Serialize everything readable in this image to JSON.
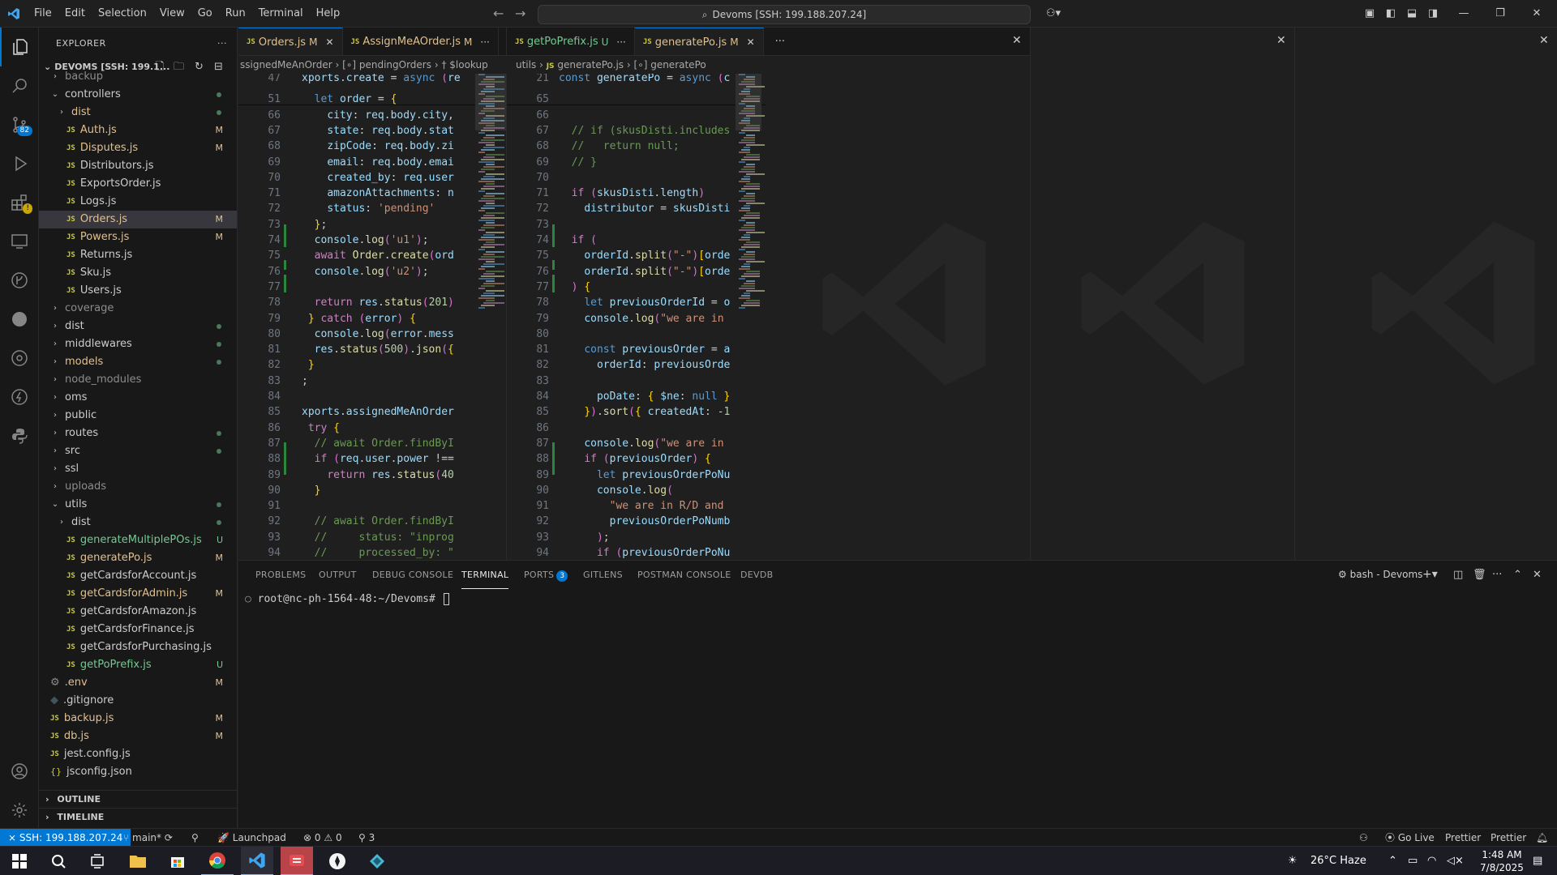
{
  "titlebar": {
    "menu": [
      "File",
      "Edit",
      "Selection",
      "View",
      "Go",
      "Run",
      "Terminal",
      "Help"
    ],
    "command_center": "Devoms [SSH: 199.188.207.24]"
  },
  "sidebar": {
    "title": "EXPLORER",
    "workspace": "DEVOMS [SSH: 199.1...",
    "items": [
      {
        "label": "backup",
        "indent": 1,
        "type": "folder",
        "open": false,
        "color": "ign",
        "status": "",
        "dot": false
      },
      {
        "label": "controllers",
        "indent": 1,
        "type": "folder",
        "open": true,
        "color": "norm",
        "status": "",
        "dot": true
      },
      {
        "label": "dist",
        "indent": 2,
        "type": "folder",
        "open": false,
        "color": "mod",
        "status": "",
        "dot": true
      },
      {
        "label": "Auth.js",
        "indent": 2,
        "type": "js",
        "color": "mod",
        "status": "M"
      },
      {
        "label": "Disputes.js",
        "indent": 2,
        "type": "js",
        "color": "mod",
        "status": "M"
      },
      {
        "label": "Distributors.js",
        "indent": 2,
        "type": "js",
        "color": "norm",
        "status": ""
      },
      {
        "label": "ExportsOrder.js",
        "indent": 2,
        "type": "js",
        "color": "norm",
        "status": ""
      },
      {
        "label": "Logs.js",
        "indent": 2,
        "type": "js",
        "color": "norm",
        "status": ""
      },
      {
        "label": "Orders.js",
        "indent": 2,
        "type": "js",
        "color": "mod",
        "status": "M",
        "selected": true
      },
      {
        "label": "Powers.js",
        "indent": 2,
        "type": "js",
        "color": "mod",
        "status": "M"
      },
      {
        "label": "Returns.js",
        "indent": 2,
        "type": "js",
        "color": "norm",
        "status": ""
      },
      {
        "label": "Sku.js",
        "indent": 2,
        "type": "js",
        "color": "norm",
        "status": ""
      },
      {
        "label": "Users.js",
        "indent": 2,
        "type": "js",
        "color": "norm",
        "status": ""
      },
      {
        "label": "coverage",
        "indent": 1,
        "type": "folder",
        "open": false,
        "color": "ign",
        "status": "",
        "dot": false
      },
      {
        "label": "dist",
        "indent": 1,
        "type": "folder",
        "open": false,
        "color": "norm",
        "status": "",
        "dot": true
      },
      {
        "label": "middlewares",
        "indent": 1,
        "type": "folder",
        "open": false,
        "color": "norm",
        "status": "",
        "dot": true
      },
      {
        "label": "models",
        "indent": 1,
        "type": "folder",
        "open": false,
        "color": "mod",
        "status": "",
        "dot": true
      },
      {
        "label": "node_modules",
        "indent": 1,
        "type": "folder",
        "open": false,
        "color": "ign",
        "status": "",
        "dot": false
      },
      {
        "label": "oms",
        "indent": 1,
        "type": "folder",
        "open": false,
        "color": "norm",
        "status": "",
        "dot": false
      },
      {
        "label": "public",
        "indent": 1,
        "type": "folder",
        "open": false,
        "color": "norm",
        "status": "",
        "dot": false
      },
      {
        "label": "routes",
        "indent": 1,
        "type": "folder",
        "open": false,
        "color": "norm",
        "status": "",
        "dot": true
      },
      {
        "label": "src",
        "indent": 1,
        "type": "folder",
        "open": false,
        "color": "norm",
        "status": "",
        "dot": true
      },
      {
        "label": "ssl",
        "indent": 1,
        "type": "folder",
        "open": false,
        "color": "norm",
        "status": "",
        "dot": false
      },
      {
        "label": "uploads",
        "indent": 1,
        "type": "folder",
        "open": false,
        "color": "ign",
        "status": "",
        "dot": false
      },
      {
        "label": "utils",
        "indent": 1,
        "type": "folder",
        "open": true,
        "color": "norm",
        "status": "",
        "dot": true
      },
      {
        "label": "dist",
        "indent": 2,
        "type": "folder",
        "open": false,
        "color": "norm",
        "status": "",
        "dot": true
      },
      {
        "label": "generateMultiplePOs.js",
        "indent": 2,
        "type": "js",
        "color": "new",
        "status": "U"
      },
      {
        "label": "generatePo.js",
        "indent": 2,
        "type": "js",
        "color": "mod",
        "status": "M"
      },
      {
        "label": "getCardsforAccount.js",
        "indent": 2,
        "type": "js",
        "color": "norm",
        "status": ""
      },
      {
        "label": "getCardsforAdmin.js",
        "indent": 2,
        "type": "js",
        "color": "mod",
        "status": "M"
      },
      {
        "label": "getCardsforAmazon.js",
        "indent": 2,
        "type": "js",
        "color": "norm",
        "status": ""
      },
      {
        "label": "getCardsforFinance.js",
        "indent": 2,
        "type": "js",
        "color": "norm",
        "status": ""
      },
      {
        "label": "getCardsforPurchasing.js",
        "indent": 2,
        "type": "js",
        "color": "norm",
        "status": ""
      },
      {
        "label": "getPoPrefix.js",
        "indent": 2,
        "type": "js",
        "color": "new",
        "status": "U"
      },
      {
        "label": ".env",
        "indent": 1,
        "type": "gear",
        "color": "mod",
        "status": "M"
      },
      {
        "label": ".gitignore",
        "indent": 1,
        "type": "git",
        "color": "norm",
        "status": ""
      },
      {
        "label": "backup.js",
        "indent": 1,
        "type": "js",
        "color": "mod",
        "status": "M"
      },
      {
        "label": "db.js",
        "indent": 1,
        "type": "js",
        "color": "mod",
        "status": "M"
      },
      {
        "label": "jest.config.js",
        "indent": 1,
        "type": "js",
        "color": "norm",
        "status": ""
      },
      {
        "label": "jsconfig.json",
        "indent": 1,
        "type": "json",
        "color": "norm",
        "status": ""
      }
    ],
    "outline": "OUTLINE",
    "timeline": "TIMELINE"
  },
  "editor1": {
    "tabs": [
      {
        "name": "Orders.js",
        "status": "M",
        "active": true
      },
      {
        "name": "AssignMeAOrder.js",
        "status": "M",
        "active": false
      }
    ],
    "breadcrumbs": [
      "ssignedMeAnOrder",
      "[∘] pendingOrders",
      "† $lookup"
    ],
    "lines": [
      {
        "n": "47",
        "c": "xports.create = async (re"
      },
      {
        "n": "51",
        "c": "  let order = {"
      },
      {
        "n": "66",
        "c": "    city: req.body.city,"
      },
      {
        "n": "67",
        "c": "    state: req.body.stat"
      },
      {
        "n": "68",
        "c": "    zipCode: req.body.zi"
      },
      {
        "n": "69",
        "c": "    email: req.body.emai"
      },
      {
        "n": "70",
        "c": "    created_by: req.user"
      },
      {
        "n": "71",
        "c": "    amazonAttachments: n"
      },
      {
        "n": "72",
        "c": "    status: 'pending'"
      },
      {
        "n": "73",
        "c": "  };"
      },
      {
        "n": "74",
        "c": "  console.log('u1');"
      },
      {
        "n": "75",
        "c": "  await Order.create(ord"
      },
      {
        "n": "76",
        "c": "  console.log('u2');"
      },
      {
        "n": "77",
        "c": ""
      },
      {
        "n": "78",
        "c": "  return res.status(201)"
      },
      {
        "n": "79",
        "c": " } catch (error) {"
      },
      {
        "n": "80",
        "c": "  console.log(error.mess"
      },
      {
        "n": "81",
        "c": "  res.status(500).json({"
      },
      {
        "n": "82",
        "c": " }"
      },
      {
        "n": "83",
        "c": ";"
      },
      {
        "n": "84",
        "c": ""
      },
      {
        "n": "85",
        "c": "xports.assignedMeAnOrder"
      },
      {
        "n": "86",
        "c": " try {"
      },
      {
        "n": "87",
        "c": "  // await Order.findByI"
      },
      {
        "n": "88",
        "c": "  if (req.user.power !=="
      },
      {
        "n": "89",
        "c": "    return res.status(40"
      },
      {
        "n": "90",
        "c": "  }"
      },
      {
        "n": "91",
        "c": ""
      },
      {
        "n": "92",
        "c": "  // await Order.findByI"
      },
      {
        "n": "93",
        "c": "  //     status: \"inprog"
      },
      {
        "n": "94",
        "c": "  //     processed_by: \""
      }
    ]
  },
  "editor2": {
    "tabs": [
      {
        "name": "getPoPrefix.js",
        "status": "U",
        "active": false
      },
      {
        "name": "generatePo.js",
        "status": "M",
        "active": true
      }
    ],
    "breadcrumbs": [
      "utils",
      "generatePo.js",
      "[∘] generatePo"
    ],
    "lines": [
      {
        "n": "21",
        "c": "const generatePo = async (c"
      },
      {
        "n": "65",
        "c": ""
      },
      {
        "n": "66",
        "c": ""
      },
      {
        "n": "67",
        "c": "  // if (skusDisti.includes"
      },
      {
        "n": "68",
        "c": "  //   return null;"
      },
      {
        "n": "69",
        "c": "  // }"
      },
      {
        "n": "70",
        "c": ""
      },
      {
        "n": "71",
        "c": "  if (skusDisti.length)"
      },
      {
        "n": "72",
        "c": "    distributor = skusDisti"
      },
      {
        "n": "73",
        "c": ""
      },
      {
        "n": "74",
        "c": "  if ("
      },
      {
        "n": "75",
        "c": "    orderId.split(\"-\")[orde"
      },
      {
        "n": "76",
        "c": "    orderId.split(\"-\")[orde"
      },
      {
        "n": "77",
        "c": "  ) {"
      },
      {
        "n": "78",
        "c": "    let previousOrderId = o"
      },
      {
        "n": "79",
        "c": "    console.log(\"we are in "
      },
      {
        "n": "80",
        "c": ""
      },
      {
        "n": "81",
        "c": "    const previousOrder = a"
      },
      {
        "n": "82",
        "c": "      orderId: previousOrde"
      },
      {
        "n": "83",
        "c": ""
      },
      {
        "n": "84",
        "c": "      poDate: { $ne: null }"
      },
      {
        "n": "85",
        "c": "    }).sort({ createdAt: -1"
      },
      {
        "n": "86",
        "c": ""
      },
      {
        "n": "87",
        "c": "    console.log(\"we are in "
      },
      {
        "n": "88",
        "c": "    if (previousOrder) {"
      },
      {
        "n": "89",
        "c": "      let previousOrderPoNu"
      },
      {
        "n": "90",
        "c": "      console.log("
      },
      {
        "n": "91",
        "c": "        \"we are in R/D and"
      },
      {
        "n": "92",
        "c": "        previousOrderPoNumb"
      },
      {
        "n": "93",
        "c": "      );"
      },
      {
        "n": "94",
        "c": "      if (previousOrderPoNu"
      }
    ]
  },
  "panel": {
    "tabs": [
      "PROBLEMS",
      "OUTPUT",
      "DEBUG CONSOLE",
      "TERMINAL",
      "PORTS",
      "GITLENS",
      "POSTMAN CONSOLE",
      "DEVDB"
    ],
    "ports_count": "3",
    "terminal_name": "bash - Devoms",
    "prompt": "root@nc-ph-1564-48:~/Devoms# "
  },
  "statusbar": {
    "remote": "SSH: 199.188.207.24",
    "branch": "main*",
    "launchpad": "Launchpad",
    "errors": "0",
    "warnings": "0",
    "ports": "3",
    "golive": "Go Live",
    "prettier1": "Prettier",
    "prettier2": "Prettier"
  },
  "taskbar": {
    "weather": "26°C  Haze",
    "time": "1:48 AM",
    "date": "7/8/2025"
  },
  "activity_badges": {
    "scm": "82"
  },
  "colors": {
    "accent": "#0078d4",
    "modified": "#e2c08d",
    "untracked": "#73c991"
  }
}
